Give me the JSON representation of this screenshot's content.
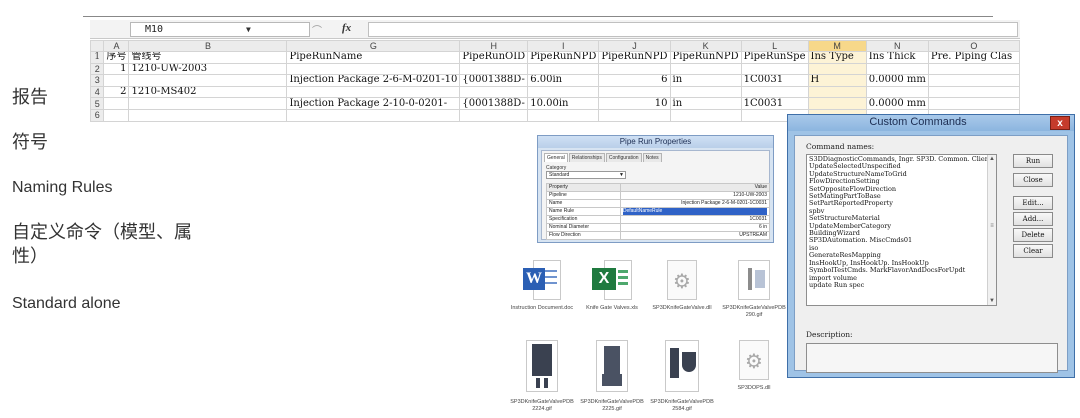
{
  "left_list": [
    {
      "label": "报告"
    },
    {
      "label": "符号"
    },
    {
      "label": "Naming Rules"
    },
    {
      "label": "自定义命令（模型、属"
    },
    {
      "label": "性）"
    },
    {
      "label": "Standard alone"
    }
  ],
  "spreadsheet": {
    "cell_ref": "M10",
    "fx_label": "fx",
    "columns": [
      "A",
      "B",
      "G",
      "H",
      "I",
      "J",
      "K",
      "L",
      "M",
      "N",
      "O"
    ],
    "row_numbers": [
      "1",
      "2",
      "3",
      "4",
      "5",
      "6"
    ],
    "header_row": [
      "序号",
      "管线号",
      "PipeRunName",
      "PipeRunOID",
      "PipeRunNPD",
      "PipeRunNPD",
      "PipeRunNPD",
      "PipeRunSpe",
      "Ins Type",
      "Ins Thick",
      "Pre. Piping Clas"
    ],
    "rows": [
      [
        "1",
        "1210-UW-2003",
        "",
        "",
        "",
        "",
        "",
        "",
        "",
        "",
        ""
      ],
      [
        "",
        "",
        "Injection Package 2-6-M-0201-10",
        "{0001388D-",
        "6.00in",
        "6",
        "in",
        "1C0031",
        "H",
        "0.0000 mm",
        ""
      ],
      [
        "2",
        "1210-MS402",
        "",
        "",
        "",
        "",
        "",
        "",
        "",
        "",
        ""
      ],
      [
        "",
        "",
        "Injection Package 2-10-0-0201-",
        "{0001388D-",
        "10.00in",
        "10",
        "in",
        "1C0031",
        "",
        "0.0000 mm",
        ""
      ],
      [
        "",
        "",
        "",
        "",
        "",
        "",
        "",
        "",
        "",
        "",
        ""
      ]
    ]
  },
  "pipe_run_properties": {
    "title": "Pipe Run Properties",
    "tabs": [
      "General",
      "Relationships",
      "Configuration",
      "Notes"
    ],
    "category_label": "Category",
    "category_value": "Standard",
    "rows": [
      {
        "property": "Property",
        "value": "Value"
      },
      {
        "property": "Pipeline",
        "value": "1210-UW-2003"
      },
      {
        "property": "Name",
        "value": "Injection Package 2-6-M-0201-1C0031"
      },
      {
        "property": "Name Rule",
        "value": "DefaultNameRule"
      },
      {
        "property": "Specification",
        "value": "1C0031"
      },
      {
        "property": "Nominal Diameter",
        "value": "6 in"
      },
      {
        "property": "Flow Direction",
        "value": "UPSTREAM"
      }
    ]
  },
  "custom_commands": {
    "title": "Custom Commands",
    "close_label": "x",
    "command_names_label": "Command names:",
    "commands": [
      "S3DDiagnosticCommands, Ingr. SP3D. Common. Client.",
      "UpdateSelectedUnspecified",
      "UpdateStructureNameToGrid",
      "FlowDirectionSetting",
      "SetOppositeFlowDirection",
      "SetMatingPartToBase",
      "SetPartReportedProperty",
      "spbv",
      "SetStructureMaterial",
      "UpdateMemberCategory",
      "BuildingWizard",
      "SP3DAutomation. MiscCmds01",
      "iso",
      "GenerateResMapping",
      "InsHookUp, InsHookUp. InsHookUp",
      "SymbolTestCmds. MarkFlavorAndDocsForUpdt",
      "import volume",
      "update Run spec"
    ],
    "buttons": {
      "run": "Run",
      "close": "Close",
      "edit": "Edit...",
      "add": "Add...",
      "delete": "Delete",
      "clear": "Clear"
    },
    "description_label": "Description:"
  },
  "files": [
    {
      "name": "Instruction Document.doc",
      "icon": "word-document-icon"
    },
    {
      "name": "Knife Gate Valves.xls",
      "icon": "excel-workbook-icon"
    },
    {
      "name": "SP3DKnifeGateValve.dll",
      "icon": "dll-gear-icon"
    },
    {
      "name": "SP3DKnifeGateValvePDB 290.gif",
      "icon": "gif-image-icon"
    },
    {
      "name": "SP3DKnifeGateValvePDB 2224.gif",
      "icon": "gif-image-icon"
    },
    {
      "name": "SP3DKnifeGateValvePDB 2225.gif",
      "icon": "gif-image-icon"
    },
    {
      "name": "SP3DKnifeGateValvePDB 2584.gif",
      "icon": "gif-image-icon"
    },
    {
      "name": "SP3DOPS.dll",
      "icon": "dll-gear-icon"
    }
  ],
  "colors": {
    "accent_blue": "#2f62c7",
    "title_blue": "#9fc3e6",
    "close_red": "#c53b2b",
    "word_blue": "#2b5fb4",
    "excel_green": "#1f7a3f",
    "active_col": "#f7d88a"
  }
}
